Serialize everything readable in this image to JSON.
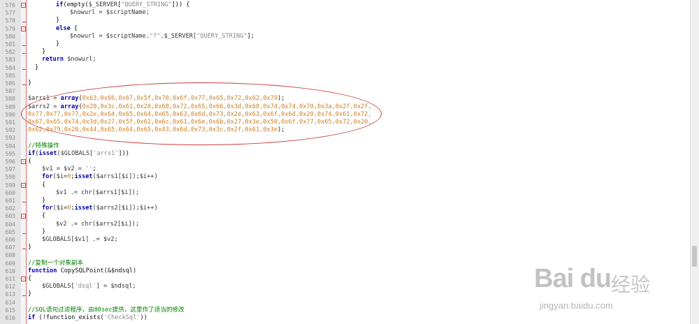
{
  "editor": {
    "lines": [
      {
        "num": "576",
        "fold": "minus",
        "indent": 2,
        "tokens": [
          {
            "t": "if",
            "c": "kw"
          },
          {
            "t": "(empty(",
            "c": "plain"
          },
          {
            "t": "$_SERVER",
            "c": "var"
          },
          {
            "t": "[",
            "c": "plain"
          },
          {
            "t": "\"QUERY_STRING\"",
            "c": "str"
          },
          {
            "t": "])) {",
            "c": "plain"
          }
        ]
      },
      {
        "num": "577",
        "fold": "bar",
        "indent": 3,
        "tokens": [
          {
            "t": "$nowurl = $scriptName;",
            "c": "var"
          }
        ]
      },
      {
        "num": "578",
        "fold": "end",
        "indent": 2,
        "tokens": [
          {
            "t": "}",
            "c": "plain"
          }
        ]
      },
      {
        "num": "579",
        "fold": "minus",
        "indent": 2,
        "tokens": [
          {
            "t": "else",
            "c": "kw"
          },
          {
            "t": " {",
            "c": "plain"
          }
        ]
      },
      {
        "num": "580",
        "fold": "bar",
        "indent": 3,
        "tokens": [
          {
            "t": "$nowurl = $scriptName.",
            "c": "var"
          },
          {
            "t": "\"?\"",
            "c": "str"
          },
          {
            "t": ".$_SERVER[",
            "c": "var"
          },
          {
            "t": "\"QUERY_STRING\"",
            "c": "str"
          },
          {
            "t": "];",
            "c": "plain"
          }
        ]
      },
      {
        "num": "581",
        "fold": "end",
        "indent": 2,
        "tokens": [
          {
            "t": "}",
            "c": "plain"
          }
        ]
      },
      {
        "num": "582",
        "fold": "end",
        "indent": 1,
        "tokens": [
          {
            "t": "}",
            "c": "plain"
          }
        ]
      },
      {
        "num": "583",
        "fold": "bar",
        "indent": 1,
        "tokens": [
          {
            "t": "return",
            "c": "kw"
          },
          {
            "t": " $nowurl;",
            "c": "var"
          }
        ]
      },
      {
        "num": "584",
        "fold": "end",
        "indent": 0.5,
        "tokens": [
          {
            "t": "}",
            "c": "plain"
          }
        ]
      },
      {
        "num": "585",
        "fold": "bar",
        "indent": 0,
        "tokens": []
      },
      {
        "num": "586",
        "fold": "end",
        "indent": 0,
        "tokens": [
          {
            "t": "}",
            "c": "plain"
          }
        ]
      },
      {
        "num": "587",
        "fold": "none",
        "indent": 0,
        "tokens": []
      },
      {
        "num": "588",
        "fold": "none",
        "indent": 0,
        "tokens": [
          {
            "t": "$arrs1 = ",
            "c": "var"
          },
          {
            "t": "array",
            "c": "kw"
          },
          {
            "t": "(",
            "c": "plain"
          },
          {
            "t": "0x63,0x66,0x67,0x5f,0x70,0x6f,0x77,0x65,0x72,0x62,0x79",
            "c": "hex"
          },
          {
            "t": ");",
            "c": "plain"
          }
        ]
      },
      {
        "num": "589",
        "fold": "none",
        "indent": 0,
        "tokens": [
          {
            "t": "$arrs2 = ",
            "c": "var"
          },
          {
            "t": "array",
            "c": "kw"
          },
          {
            "t": "(",
            "c": "plain"
          },
          {
            "t": "0x20,0x3c,0x61,0x20,0x68,0x72,0x65,0x66,0x3d,0x68,0x74,0x74,0x70,0x3a,0x2f,0x2f,",
            "c": "hex"
          }
        ]
      },
      {
        "num": "590",
        "fold": "none",
        "indent": 0,
        "tokens": [
          {
            "t": "0x77,0x77,0x77,0x2e,0x64,0x65,0x64,0x65,0x63,0x6d,0x73,0x2e,0x63,0x6f,0x6d,0x20,0x74,0x61,0x72,",
            "c": "hex"
          }
        ]
      },
      {
        "num": "591",
        "fold": "none",
        "indent": 0,
        "tokens": [
          {
            "t": "0x67,0x65,0x74,0x3d,0x27,0x5f,0x62,0x6c,0x61,0x6e,0x6b,0x27,0x3e,0x50,0x6f,0x77,0x65,0x72,0x20,",
            "c": "hex"
          }
        ]
      },
      {
        "num": "592",
        "fold": "none",
        "indent": 0,
        "tokens": [
          {
            "t": "0x62,0x79,0x20,0x44,0x65,0x64,0x65,0x43,0x6d,0x73,0x3c,0x2f,0x61,0x3e",
            "c": "hex"
          },
          {
            "t": ");",
            "c": "plain"
          }
        ]
      },
      {
        "num": "593",
        "fold": "none",
        "indent": 0,
        "tokens": []
      },
      {
        "num": "594",
        "fold": "none",
        "indent": 0,
        "tokens": [
          {
            "t": "//特殊操作",
            "c": "cm"
          }
        ]
      },
      {
        "num": "595",
        "fold": "none",
        "indent": 0,
        "tokens": [
          {
            "t": "if",
            "c": "kw"
          },
          {
            "t": "(",
            "c": "plain"
          },
          {
            "t": "isset",
            "c": "kw"
          },
          {
            "t": "($GLOBALS[",
            "c": "var"
          },
          {
            "t": "'arrs1'",
            "c": "str"
          },
          {
            "t": "]))",
            "c": "plain"
          }
        ]
      },
      {
        "num": "596",
        "fold": "minus",
        "indent": 0,
        "tokens": [
          {
            "t": "{",
            "c": "plain"
          }
        ]
      },
      {
        "num": "597",
        "fold": "bar",
        "indent": 1,
        "tokens": [
          {
            "t": "$v1 = $v2 = ",
            "c": "var"
          },
          {
            "t": "''",
            "c": "str"
          },
          {
            "t": ";",
            "c": "plain"
          }
        ]
      },
      {
        "num": "598",
        "fold": "bar",
        "indent": 1,
        "tokens": [
          {
            "t": "for",
            "c": "kw"
          },
          {
            "t": "($i=",
            "c": "var"
          },
          {
            "t": "0",
            "c": "hex"
          },
          {
            "t": ";",
            "c": "plain"
          },
          {
            "t": "isset",
            "c": "kw"
          },
          {
            "t": "($arrs1[$i]);$i++)",
            "c": "var"
          }
        ]
      },
      {
        "num": "599",
        "fold": "minus",
        "indent": 1,
        "tokens": [
          {
            "t": "{",
            "c": "plain"
          }
        ]
      },
      {
        "num": "600",
        "fold": "bar",
        "indent": 2,
        "tokens": [
          {
            "t": "$v1 .= chr($arrs1[$i]);",
            "c": "var"
          }
        ]
      },
      {
        "num": "601",
        "fold": "end",
        "indent": 1,
        "tokens": [
          {
            "t": "}",
            "c": "plain"
          }
        ]
      },
      {
        "num": "602",
        "fold": "bar",
        "indent": 1,
        "tokens": [
          {
            "t": "for",
            "c": "kw"
          },
          {
            "t": "($i=",
            "c": "var"
          },
          {
            "t": "0",
            "c": "hex"
          },
          {
            "t": ";",
            "c": "plain"
          },
          {
            "t": "isset",
            "c": "kw"
          },
          {
            "t": "($arrs2[$i]);$i++)",
            "c": "var"
          }
        ]
      },
      {
        "num": "603",
        "fold": "minus",
        "indent": 1,
        "tokens": [
          {
            "t": "{",
            "c": "plain"
          }
        ]
      },
      {
        "num": "604",
        "fold": "bar",
        "indent": 2,
        "tokens": [
          {
            "t": "$v2 .= chr($arrs2[$i]);",
            "c": "var"
          }
        ]
      },
      {
        "num": "605",
        "fold": "end",
        "indent": 1,
        "tokens": [
          {
            "t": "}",
            "c": "plain"
          }
        ]
      },
      {
        "num": "606",
        "fold": "bar",
        "indent": 1,
        "tokens": [
          {
            "t": "$GLOBALS[$v1] .= $v2;",
            "c": "var"
          }
        ]
      },
      {
        "num": "607",
        "fold": "end",
        "indent": 0,
        "tokens": [
          {
            "t": "}",
            "c": "plain"
          }
        ]
      },
      {
        "num": "608",
        "fold": "none",
        "indent": 0,
        "tokens": []
      },
      {
        "num": "609",
        "fold": "none",
        "indent": 0,
        "tokens": [
          {
            "t": "//复制一个对象副本",
            "c": "cm"
          }
        ]
      },
      {
        "num": "610",
        "fold": "none",
        "indent": 0,
        "tokens": [
          {
            "t": "function",
            "c": "kw"
          },
          {
            "t": " CopySQLPoint(&$ndsql)",
            "c": "plain"
          }
        ]
      },
      {
        "num": "611",
        "fold": "minus",
        "indent": 0,
        "tokens": [
          {
            "t": "{",
            "c": "plain"
          }
        ]
      },
      {
        "num": "612",
        "fold": "bar",
        "indent": 1,
        "tokens": [
          {
            "t": "$GLOBALS[",
            "c": "var"
          },
          {
            "t": "'dsql'",
            "c": "str"
          },
          {
            "t": "] = $ndsql;",
            "c": "var"
          }
        ]
      },
      {
        "num": "613",
        "fold": "end",
        "indent": 0,
        "tokens": [
          {
            "t": "}",
            "c": "plain"
          }
        ]
      },
      {
        "num": "614",
        "fold": "none",
        "indent": 0,
        "tokens": []
      },
      {
        "num": "615",
        "fold": "none",
        "indent": 0,
        "tokens": [
          {
            "t": "//SQL语句过滤程序，由80sec提供，这里作了适当的修改",
            "c": "cm"
          }
        ]
      },
      {
        "num": "616",
        "fold": "none",
        "indent": 0,
        "tokens": [
          {
            "t": "if",
            "c": "kw"
          },
          {
            "t": " (!function_exists(",
            "c": "plain"
          },
          {
            "t": "'CheckSql'",
            "c": "str"
          },
          {
            "t": "))",
            "c": "plain"
          }
        ]
      }
    ]
  },
  "watermark": {
    "brand": "Bai du",
    "brand_cn": "经验",
    "url": "jingyan.baidu.com"
  },
  "colors": {
    "keyword": "#0000aa",
    "hex": "#d08020",
    "comment": "#008000",
    "highlight_oval": "#c83c3c"
  }
}
